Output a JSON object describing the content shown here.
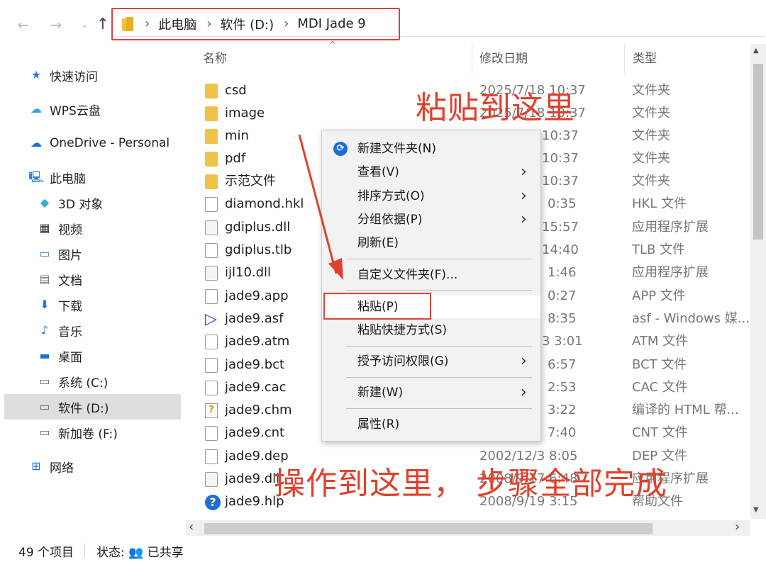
{
  "addressbar": {
    "back": "←",
    "forward": "→",
    "recent": "⌄",
    "up": "↑",
    "crumbs": [
      "此电脑",
      "软件 (D:)",
      "MDI Jade 9"
    ]
  },
  "sidebar": {
    "items": [
      {
        "label": "快速访问",
        "icon": "star-icon"
      },
      {
        "label": "WPS云盘",
        "icon": "cloud-icon"
      },
      {
        "label": "OneDrive - Personal",
        "icon": "onedrive-icon"
      },
      {
        "label": "此电脑",
        "icon": "computer-icon"
      },
      {
        "label": "3D 对象",
        "icon": "cube-icon"
      },
      {
        "label": "视频",
        "icon": "video-icon"
      },
      {
        "label": "图片",
        "icon": "picture-icon"
      },
      {
        "label": "文档",
        "icon": "document-icon"
      },
      {
        "label": "下载",
        "icon": "download-icon"
      },
      {
        "label": "音乐",
        "icon": "music-icon"
      },
      {
        "label": "桌面",
        "icon": "desktop-icon"
      },
      {
        "label": "系统 (C:)",
        "icon": "drive-icon"
      },
      {
        "label": "软件 (D:)",
        "icon": "drive-icon"
      },
      {
        "label": "新加卷 (F:)",
        "icon": "drive-icon"
      },
      {
        "label": "网络",
        "icon": "network-icon"
      }
    ]
  },
  "columns": {
    "name": "名称",
    "date": "修改日期",
    "type": "类型"
  },
  "files": [
    {
      "name": "csd",
      "date": "2025/7/18 10:37",
      "type": "文件夹",
      "icon": "folder"
    },
    {
      "name": "image",
      "date": "2025/7/18 10:37",
      "type": "文件夹",
      "icon": "folder"
    },
    {
      "name": "min",
      "date": "10:37",
      "type": "文件夹",
      "icon": "folder"
    },
    {
      "name": "pdf",
      "date": "10:37",
      "type": "文件夹",
      "icon": "folder"
    },
    {
      "name": "示范文件",
      "date": "10:37",
      "type": "文件夹",
      "icon": "folder"
    },
    {
      "name": "diamond.hkl",
      "date": "0:35",
      "type": "HKL 文件",
      "icon": "doc"
    },
    {
      "name": "gdiplus.dll",
      "date": "15:57",
      "type": "应用程序扩展",
      "icon": "dll"
    },
    {
      "name": "gdiplus.tlb",
      "date": "14:40",
      "type": "TLB 文件",
      "icon": "doc"
    },
    {
      "name": "ijl10.dll",
      "date": "1:46",
      "type": "应用程序扩展",
      "icon": "dll"
    },
    {
      "name": "jade9.app",
      "date": "0:27",
      "type": "APP 文件",
      "icon": "doc"
    },
    {
      "name": "jade9.asf",
      "date": "8:35",
      "type": "asf - Windows 媒...",
      "icon": "media"
    },
    {
      "name": "jade9.atm",
      "date": "3 3:01",
      "type": "ATM 文件",
      "icon": "doc"
    },
    {
      "name": "jade9.bct",
      "date": "6:57",
      "type": "BCT 文件",
      "icon": "doc"
    },
    {
      "name": "jade9.cac",
      "date": "2:53",
      "type": "CAC 文件",
      "icon": "doc"
    },
    {
      "name": "jade9.chm",
      "date": "3:22",
      "type": "编译的 HTML 帮...",
      "icon": "chm"
    },
    {
      "name": "jade9.cnt",
      "date": "7:40",
      "type": "CNT 文件",
      "icon": "doc"
    },
    {
      "name": "jade9.dep",
      "date": "2002/12/3 8:05",
      "type": "DEP 文件",
      "icon": "doc"
    },
    {
      "name": "jade9.dll",
      "date": "2008/9/17 6:48",
      "type": "应用程序扩展",
      "icon": "dll"
    },
    {
      "name": "jade9.hlp",
      "date": "2008/9/19 3:15",
      "type": "帮助文件",
      "icon": "help"
    }
  ],
  "context_menu": {
    "items": [
      {
        "label": "新建文件夹(N)"
      },
      {
        "label": "查看(V)",
        "submenu": true
      },
      {
        "label": "排序方式(O)",
        "submenu": true
      },
      {
        "label": "分组依据(P)",
        "submenu": true
      },
      {
        "label": "刷新(E)"
      },
      {
        "label": "自定义文件夹(F)..."
      },
      {
        "label": "粘贴(P)"
      },
      {
        "label": "粘贴快捷方式(S)"
      },
      {
        "label": "授予访问权限(G)",
        "submenu": true
      },
      {
        "label": "新建(W)",
        "submenu": true
      },
      {
        "label": "属性(R)"
      }
    ]
  },
  "status": {
    "count": "49 个项目",
    "state": "状态: 👥 已共享"
  },
  "annotations": {
    "top": "粘贴到这里",
    "bottom": "操作到这里， 步骤全部完成"
  },
  "colors": {
    "annotation": "#e0402c",
    "folder": "#f1c24a",
    "accent": "#1a6fd8"
  }
}
